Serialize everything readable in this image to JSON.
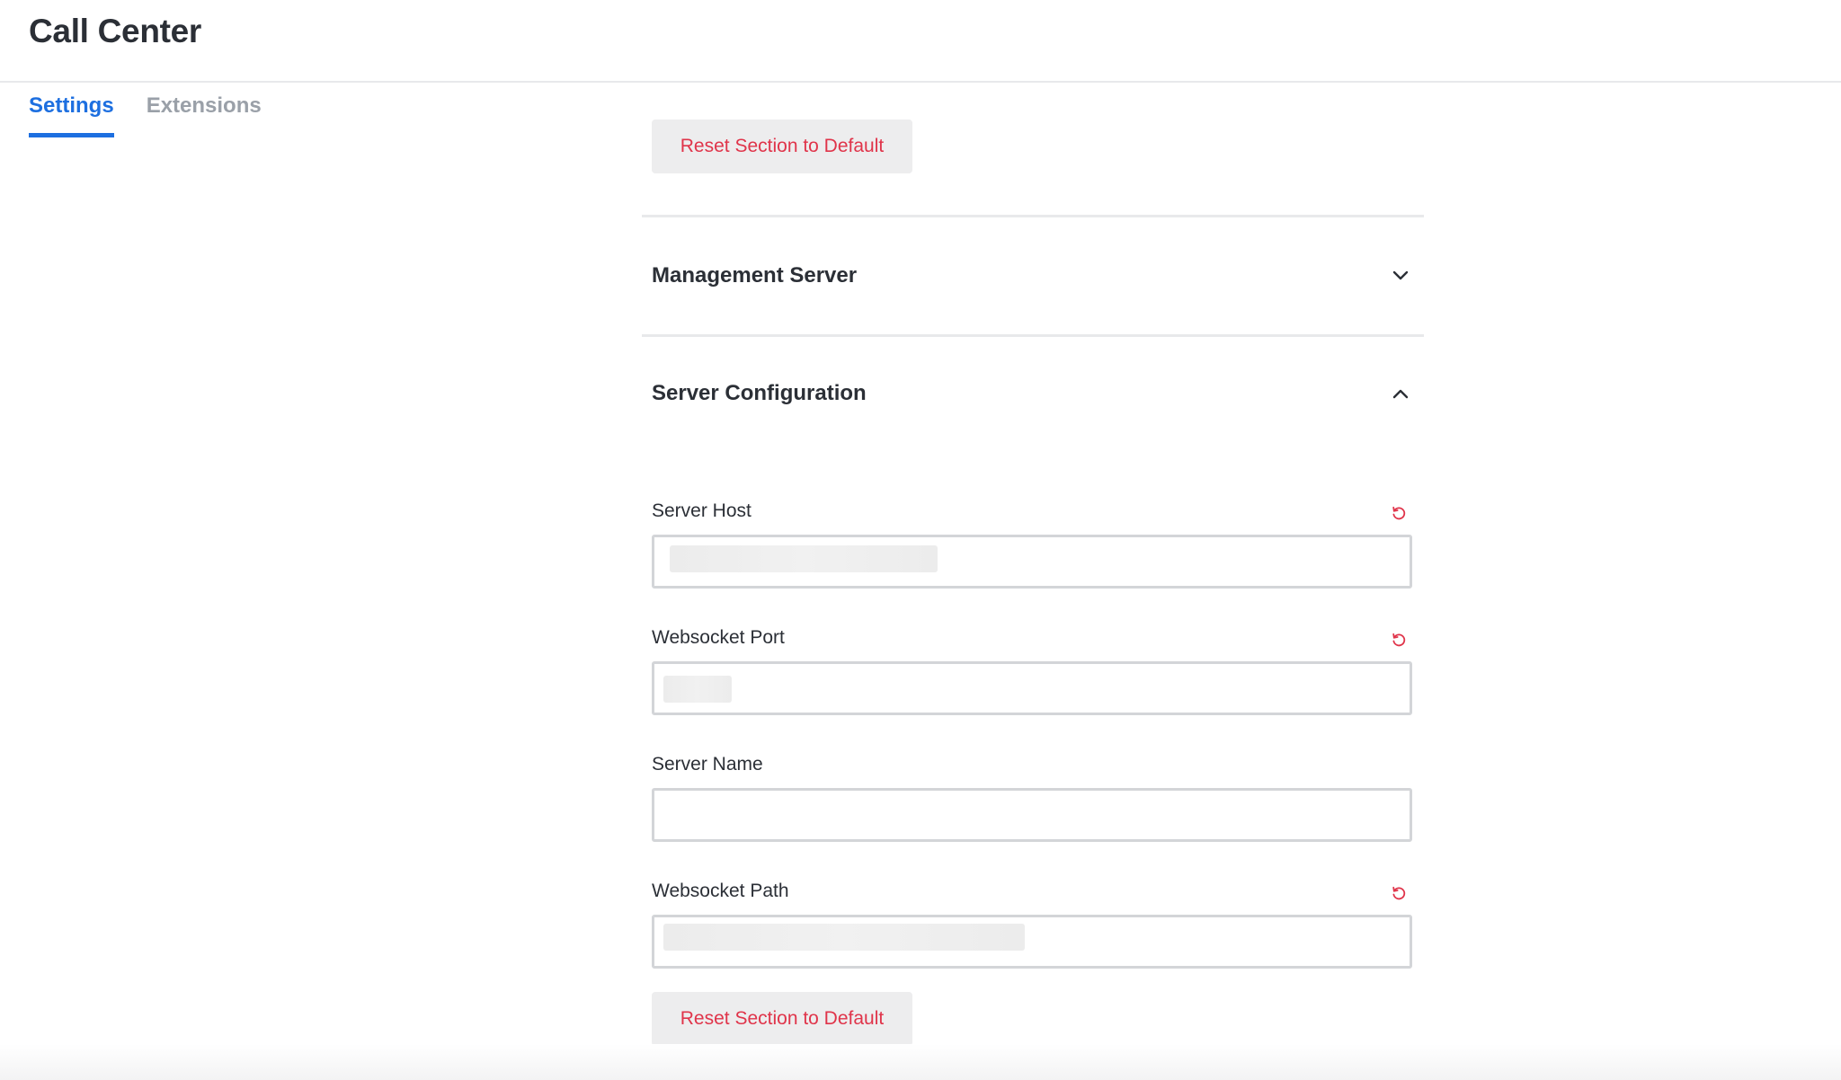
{
  "app": {
    "title": "Call Center"
  },
  "tabs": [
    {
      "label": "Settings",
      "active": true
    },
    {
      "label": "Extensions",
      "active": false
    }
  ],
  "sections": {
    "reset_label": "Reset Section to Default",
    "management_server": {
      "title": "Management Server",
      "expanded": false
    },
    "server_configuration": {
      "title": "Server Configuration",
      "expanded": true,
      "fields": [
        {
          "label": "Server Host",
          "value": "",
          "resettable": true
        },
        {
          "label": "Websocket Port",
          "value": "",
          "resettable": true
        },
        {
          "label": "Server Name",
          "value": "",
          "resettable": false
        },
        {
          "label": "Websocket Path",
          "value": "",
          "resettable": true
        }
      ]
    }
  },
  "colors": {
    "accent": "#1d6fe0",
    "danger": "#e0344a",
    "muted_tab": "#9aa0a8",
    "button_bg": "#ededee",
    "border": "#d3d5d8"
  },
  "icons": {
    "collapsed": "chevron-down-icon",
    "expanded": "chevron-up-icon",
    "reset": "reset-icon"
  }
}
